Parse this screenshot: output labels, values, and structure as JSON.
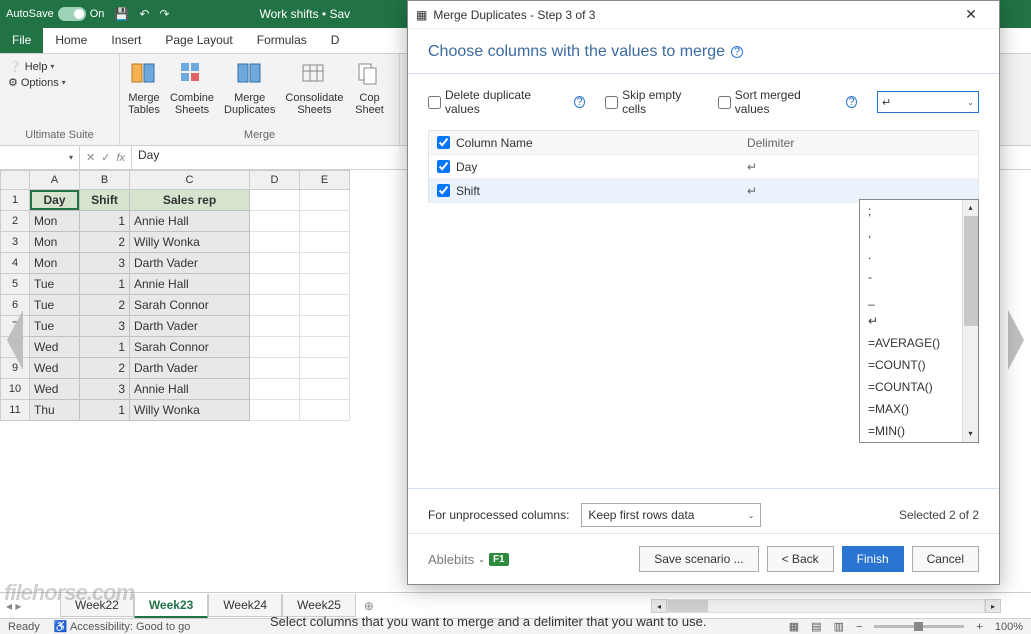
{
  "titlebar": {
    "autosave": "AutoSave",
    "on": "On",
    "doc": "Work shifts • Sav"
  },
  "tabs": [
    "File",
    "Home",
    "Insert",
    "Page Layout",
    "Formulas",
    "D"
  ],
  "helpopts": {
    "help": "Help",
    "options": "Options"
  },
  "ribbon_group1": "Ultimate Suite",
  "ribbon_buttons": [
    "Merge\nTables",
    "Combine\nSheets",
    "Merge\nDuplicates",
    "Consolidate\nSheets",
    "Cop\nSheet"
  ],
  "ribbon_group2": "Merge",
  "namebox": "",
  "fx": "fx",
  "formula": "Day",
  "cols": [
    "A",
    "B",
    "C",
    "D",
    "E"
  ],
  "headerRow": {
    "a": "Day",
    "b": "Shift",
    "c": "Sales rep"
  },
  "rows": [
    {
      "n": "2",
      "a": "Mon",
      "b": "1",
      "c": "Annie Hall"
    },
    {
      "n": "3",
      "a": "Mon",
      "b": "2",
      "c": "Willy Wonka"
    },
    {
      "n": "4",
      "a": "Mon",
      "b": "3",
      "c": "Darth Vader"
    },
    {
      "n": "5",
      "a": "Tue",
      "b": "1",
      "c": "Annie Hall"
    },
    {
      "n": "6",
      "a": "Tue",
      "b": "2",
      "c": "Sarah Connor"
    },
    {
      "n": "7",
      "a": "Tue",
      "b": "3",
      "c": "Darth Vader"
    },
    {
      "n": "8",
      "a": "Wed",
      "b": "1",
      "c": "Sarah Connor"
    },
    {
      "n": "9",
      "a": "Wed",
      "b": "2",
      "c": "Darth Vader"
    },
    {
      "n": "10",
      "a": "Wed",
      "b": "3",
      "c": "Annie Hall"
    },
    {
      "n": "11",
      "a": "Thu",
      "b": "1",
      "c": "Willy Wonka"
    }
  ],
  "sheets": [
    "Week22",
    "Week23",
    "Week24",
    "Week25"
  ],
  "status": {
    "ready": "Ready",
    "acc": "Accessibility: Good to go",
    "zoom": "100%"
  },
  "dialog": {
    "title": "Merge Duplicates - Step 3 of 3",
    "heading": "Choose columns with the values to merge",
    "chk_delete": "Delete duplicate values",
    "chk_skip": "Skip empty cells",
    "chk_sort": "Sort merged values",
    "delim_current": "↵",
    "col_head": "Column Name",
    "delim_head": "Delimiter",
    "cols": [
      {
        "name": "Day",
        "delim": "↵",
        "sel": false
      },
      {
        "name": "Shift",
        "delim": "↵",
        "sel": true
      }
    ],
    "dropdown": [
      ";",
      ",",
      ".",
      "-",
      "_",
      "↵",
      "=AVERAGE()",
      "=COUNT()",
      "=COUNTA()",
      "=MAX()",
      "=MIN()"
    ],
    "unprocessed_label": "For unprocessed columns:",
    "unprocessed_value": "Keep first rows data",
    "selected_text": "Selected 2 of 2",
    "ablebits": "Ablebits",
    "save_scenario": "Save scenario ...",
    "back": "< Back",
    "finish": "Finish",
    "cancel": "Cancel"
  },
  "caption": "Select columns that you want to merge and a delimiter that you want to use.",
  "watermark": "filehorse.com"
}
